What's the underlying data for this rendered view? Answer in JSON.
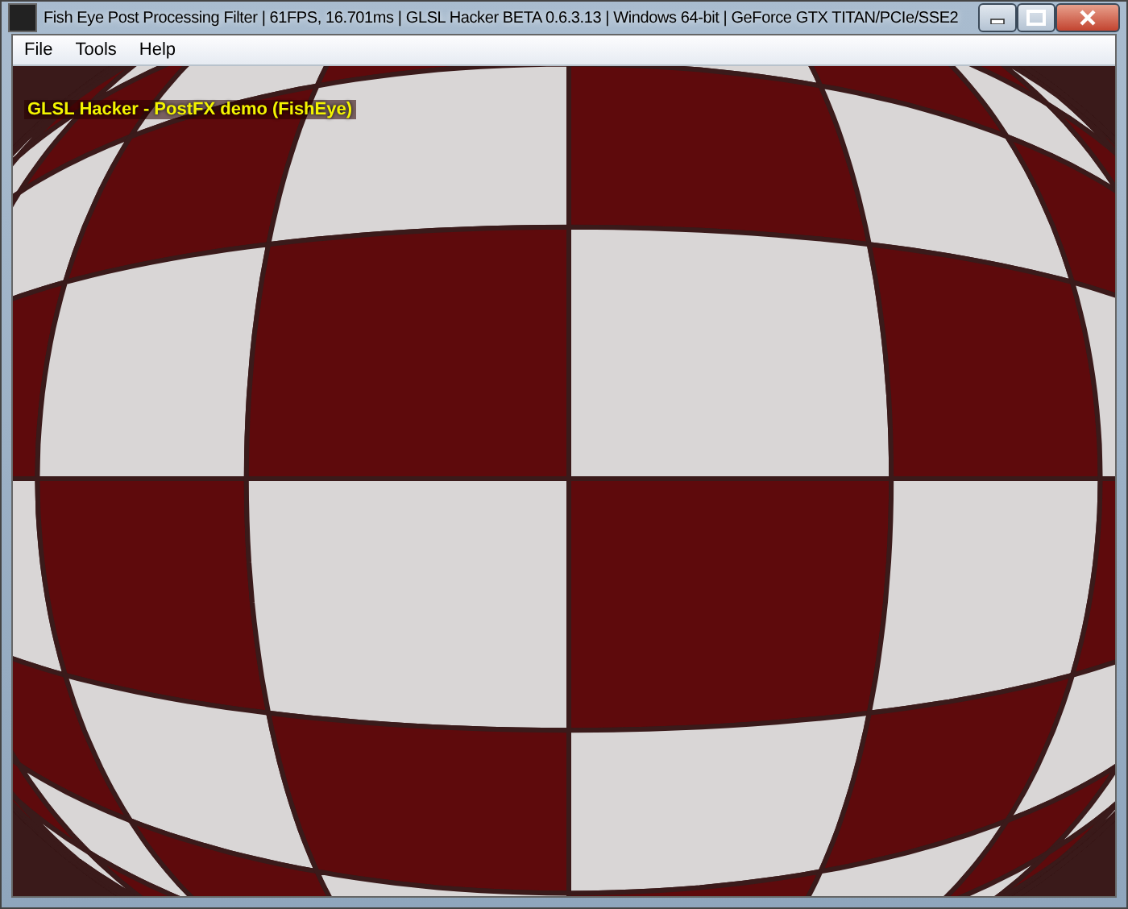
{
  "window": {
    "title": "Fish Eye Post Processing Filter | 61FPS, 16.701ms | GLSL Hacker BETA 0.6.3.13 | Windows 64-bit | GeForce GTX TITAN/PCIe/SSE2"
  },
  "menu": [
    "File",
    "Tools",
    "Help"
  ],
  "viewport": {
    "overlay_text": "GLSL Hacker - PostFX demo (FishEye)"
  }
}
